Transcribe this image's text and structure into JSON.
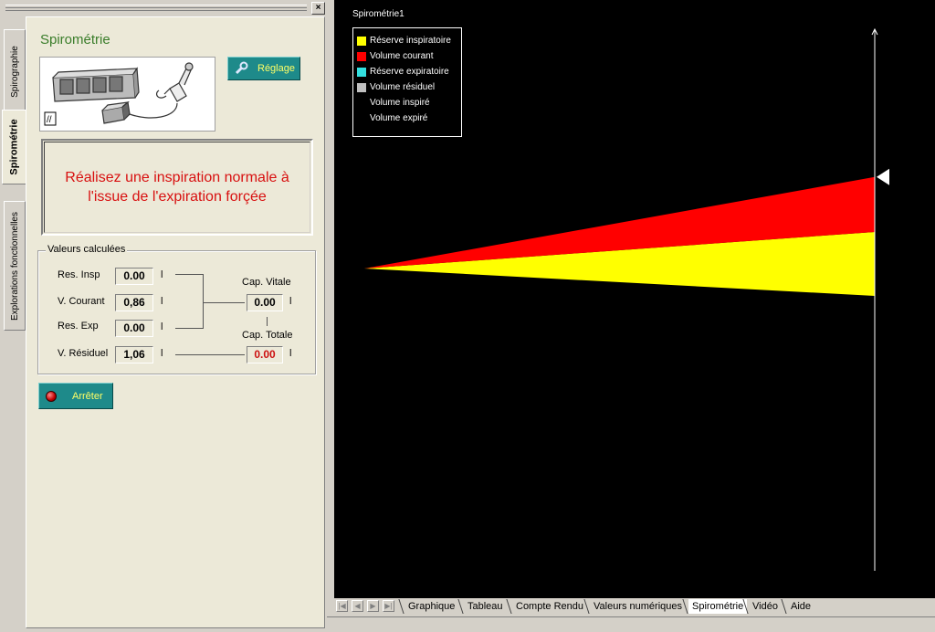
{
  "panel": {
    "close_glyph": "×",
    "vertical_tabs": [
      {
        "label": "Spirographie",
        "active": false
      },
      {
        "label": "Spirométrie",
        "active": true
      },
      {
        "label": "Explorations fonctionnelles",
        "active": false
      }
    ],
    "title": "Spirométrie",
    "reglage_label": "Réglage",
    "message": "Réalisez une inspiration normale à l'issue de l'expiration forçée",
    "values_group_title": "Valeurs calculées",
    "rows": [
      {
        "label": "Res. Insp",
        "value": "0.00",
        "unit": "l"
      },
      {
        "label": "V. Courant",
        "value": "0,86",
        "unit": "l"
      },
      {
        "label": "Res. Exp",
        "value": "0.00",
        "unit": "l"
      },
      {
        "label": "V. Résiduel",
        "value": "1,06",
        "unit": "l"
      }
    ],
    "cap_vitale": {
      "label": "Cap. Vitale",
      "value": "0.00",
      "unit": "l"
    },
    "cap_totale": {
      "label": "Cap. Totale",
      "value": "0.00",
      "unit": "l",
      "color": "#cc1010"
    },
    "stop_label": "Arrêter",
    "colors": {
      "button_teal": "#1e8a8a",
      "button_text": "#ffff66",
      "title_green": "#3a7d2a",
      "message_red": "#d81010"
    }
  },
  "chart": {
    "title": "Spirométrie1",
    "legend": [
      {
        "label": "Réserve inspiratoire",
        "color": "#ffff00"
      },
      {
        "label": "Volume courant",
        "color": "#ff0000"
      },
      {
        "label": "Réserve expiratoire",
        "color": "#33e0e0"
      },
      {
        "label": "Volume résiduel",
        "color": "#c0c0c0"
      },
      {
        "label": "Volume inspiré",
        "color": null
      },
      {
        "label": "Volume expiré",
        "color": null
      }
    ],
    "background": "#000000"
  },
  "chart_data": {
    "type": "area",
    "title": "Spirométrie1",
    "series": [
      {
        "name": "Réserve inspiratoire",
        "color": "#ffff00",
        "values": [
          0,
          1.0
        ]
      },
      {
        "name": "Volume courant",
        "color": "#ff0000",
        "values": [
          0,
          0.86
        ]
      },
      {
        "name": "Réserve expiratoire",
        "color": "#33e0e0",
        "values": [
          0,
          0
        ]
      },
      {
        "name": "Volume résiduel",
        "color": "#c0c0c0",
        "values": [
          0,
          0
        ]
      }
    ],
    "grid": false,
    "legend_position": "top-left"
  },
  "bottom_tabs": {
    "nav": [
      "|◀",
      "◀",
      "▶",
      "▶|"
    ],
    "tabs": [
      {
        "label": "Graphique",
        "active": false
      },
      {
        "label": "Tableau",
        "active": false
      },
      {
        "label": "Compte Rendu",
        "active": false
      },
      {
        "label": "Valeurs numériques",
        "active": false
      },
      {
        "label": "Spirométrie",
        "active": true
      },
      {
        "label": "Vidéo",
        "active": false
      },
      {
        "label": "Aide",
        "active": false
      }
    ]
  }
}
